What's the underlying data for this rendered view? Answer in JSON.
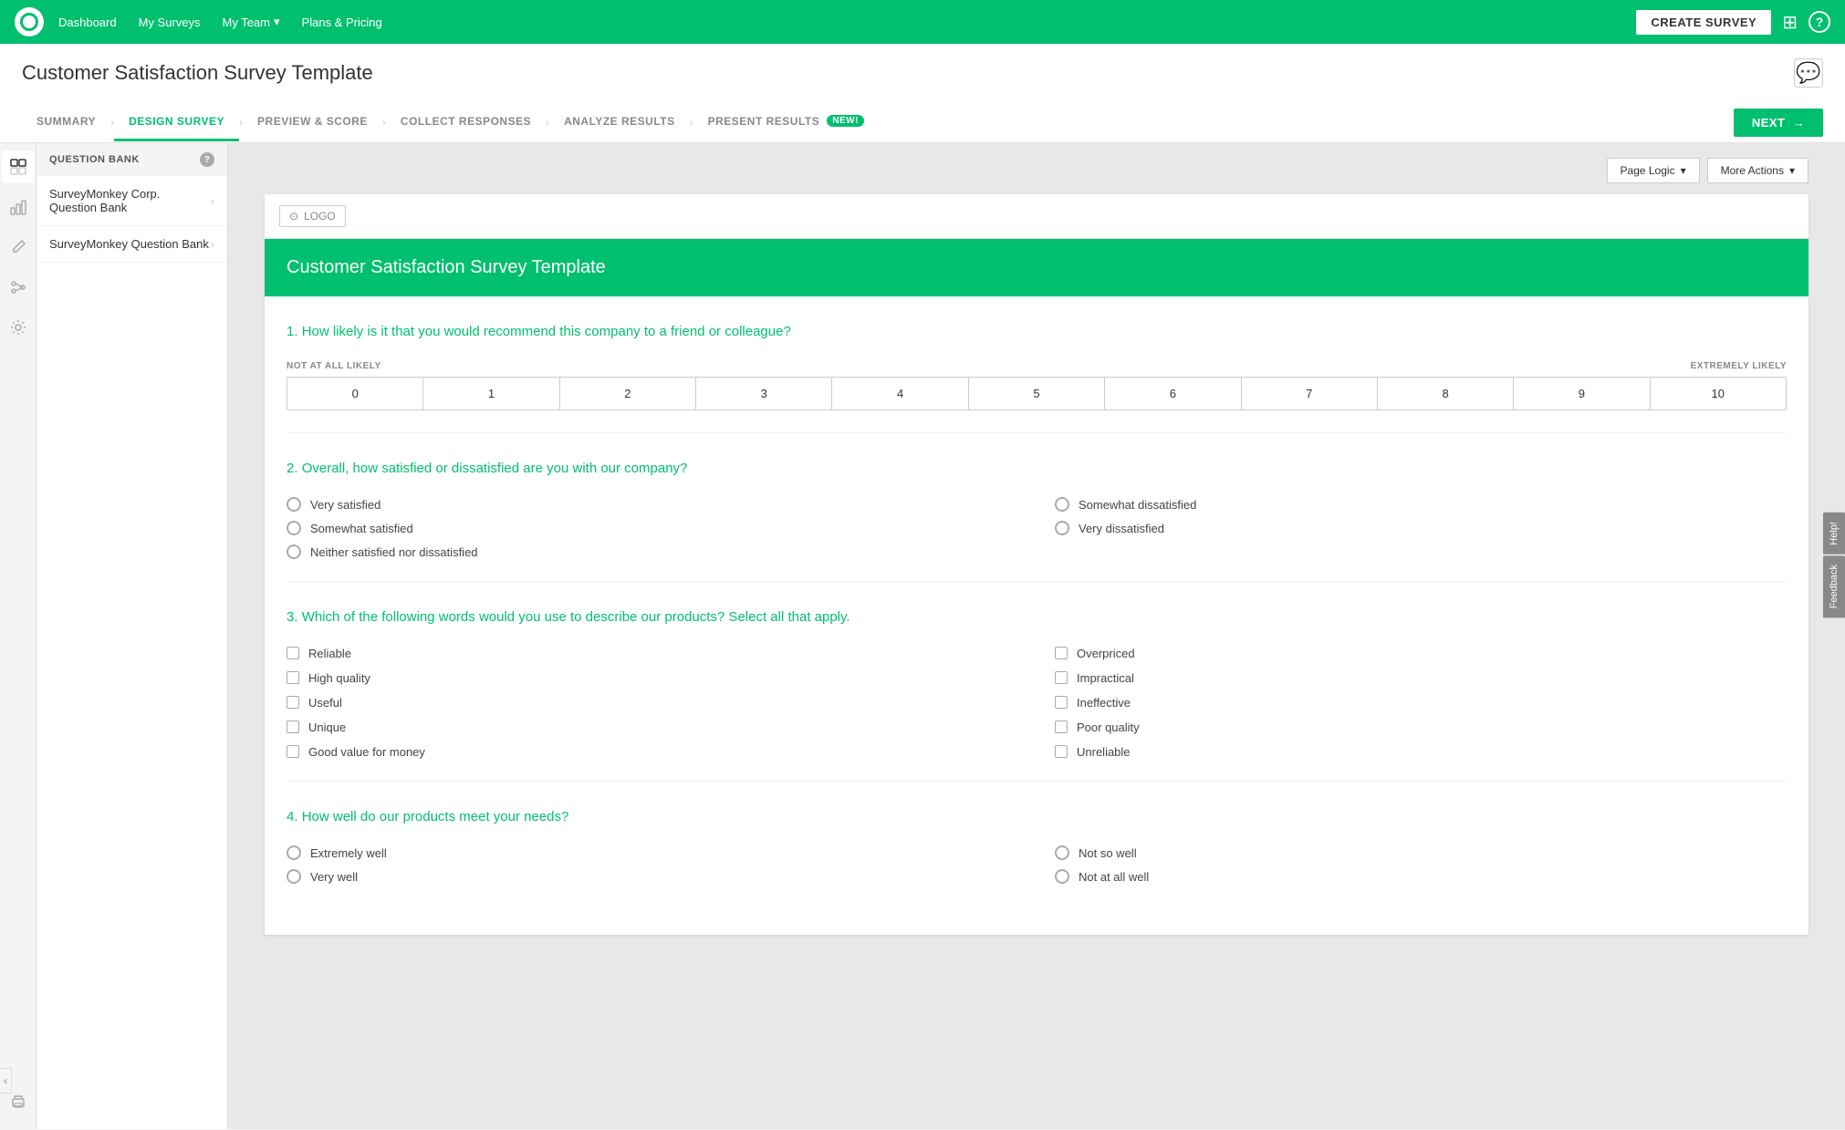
{
  "nav": {
    "links": [
      {
        "label": "Dashboard",
        "id": "dashboard"
      },
      {
        "label": "My Surveys",
        "id": "my-surveys"
      },
      {
        "label": "My Team",
        "id": "my-team",
        "hasDropdown": true
      },
      {
        "label": "Plans & Pricing",
        "id": "plans-pricing"
      }
    ],
    "create_survey_label": "CREATE SURVEY",
    "grid_icon": "⊞",
    "help_icon": "?"
  },
  "page": {
    "title": "Customer Satisfaction Survey Template",
    "comment_icon": "💬"
  },
  "tabs": [
    {
      "id": "summary",
      "label": "SUMMARY"
    },
    {
      "id": "design-survey",
      "label": "DESIGN SURVEY",
      "active": true
    },
    {
      "id": "preview-score",
      "label": "PREVIEW & SCORE"
    },
    {
      "id": "collect-responses",
      "label": "COLLECT RESPONSES"
    },
    {
      "id": "analyze-results",
      "label": "ANALYZE RESULTS"
    },
    {
      "id": "present-results",
      "label": "PRESENT RESULTS",
      "isNew": true
    }
  ],
  "next_button": "NEXT",
  "sidebar_icons": [
    {
      "id": "question-bank",
      "icon": "▦",
      "active": true
    },
    {
      "id": "analytics",
      "icon": "📊"
    },
    {
      "id": "edit",
      "icon": "✏️"
    },
    {
      "id": "logic",
      "icon": "⊕"
    },
    {
      "id": "settings",
      "icon": "⊞"
    }
  ],
  "question_bank": {
    "header": "QUESTION BANK",
    "help_icon": "?",
    "items": [
      {
        "label": "SurveyMonkey Corp. Question Bank",
        "id": "corp-bank"
      },
      {
        "label": "SurveyMonkey Question Bank",
        "id": "sm-bank"
      }
    ]
  },
  "toolbar": {
    "page_logic_label": "Page Logic",
    "more_actions_label": "More Actions"
  },
  "survey": {
    "logo_label": "LOGO",
    "title": "Customer Satisfaction Survey Template",
    "questions": [
      {
        "number": "1.",
        "text": "How likely is it that you would recommend this company to a friend or colleague?",
        "type": "nps",
        "nps": {
          "min_label": "NOT AT ALL LIKELY",
          "max_label": "EXTREMELY LIKELY",
          "values": [
            "0",
            "1",
            "2",
            "3",
            "4",
            "5",
            "6",
            "7",
            "8",
            "9",
            "10"
          ]
        }
      },
      {
        "number": "2.",
        "text": "Overall, how satisfied or dissatisfied are you with our company?",
        "type": "radio",
        "options_left": [
          "Very satisfied",
          "Somewhat satisfied",
          "Neither satisfied nor dissatisfied"
        ],
        "options_right": [
          "Somewhat dissatisfied",
          "Very dissatisfied"
        ]
      },
      {
        "number": "3.",
        "text": "Which of the following words would you use to describe our products? Select all that apply.",
        "type": "checkbox",
        "options_left": [
          "Reliable",
          "High quality",
          "Useful",
          "Unique",
          "Good value for money"
        ],
        "options_right": [
          "Overpriced",
          "Impractical",
          "Ineffective",
          "Poor quality",
          "Unreliable"
        ]
      },
      {
        "number": "4.",
        "text": "How well do our products meet your needs?",
        "type": "radio",
        "options_left": [
          "Extremely well",
          "Very well"
        ],
        "options_right": [
          "Not so well",
          "Not at all well"
        ]
      }
    ]
  },
  "help_tabs": [
    "Help!",
    "Feedback"
  ],
  "collapse_arrow": "‹"
}
